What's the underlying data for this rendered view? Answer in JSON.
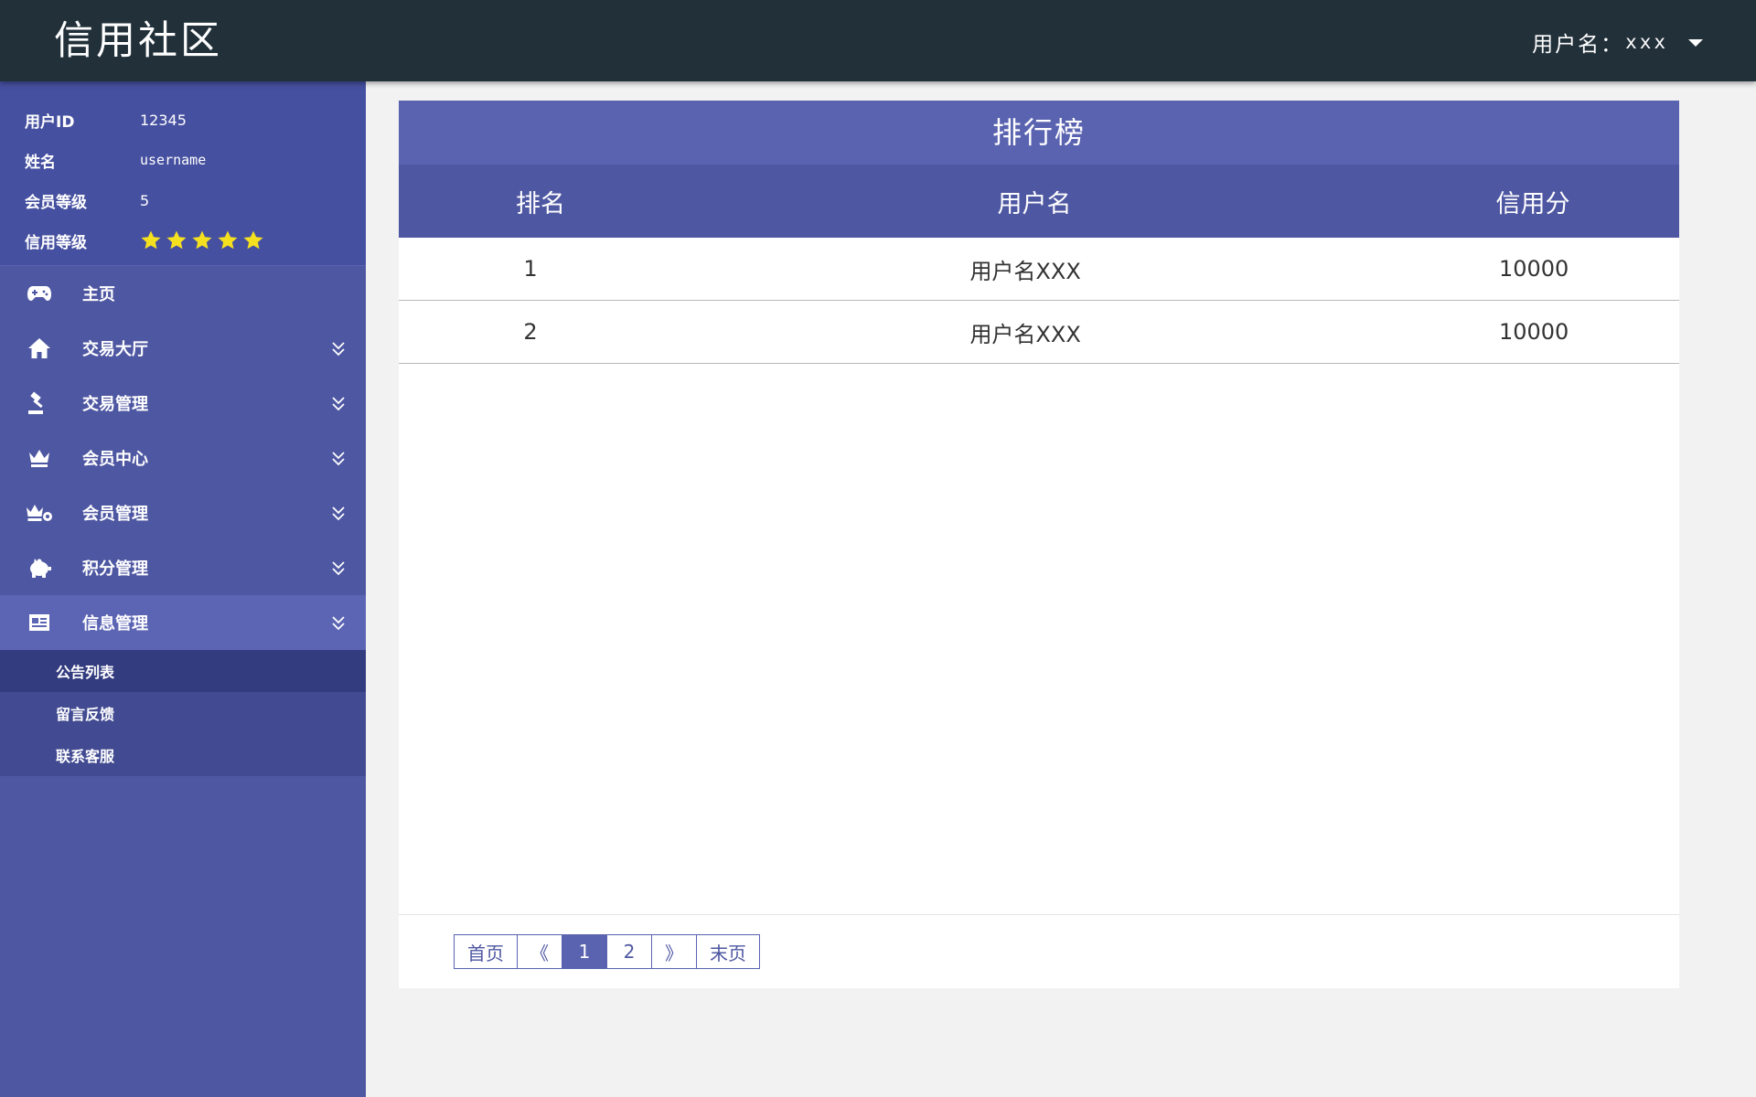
{
  "header": {
    "brand": "信用社区",
    "user_prefix": "用户名：",
    "user_name": "xxx"
  },
  "profile": {
    "rows": [
      {
        "label": "用户ID",
        "value": "12345"
      },
      {
        "label": "姓名",
        "value": "username"
      },
      {
        "label": "会员等级",
        "value": "5"
      },
      {
        "label": "信用等级",
        "value": ""
      }
    ],
    "credit_stars": 5,
    "star_color": "#f5e020"
  },
  "sidebar": {
    "items": [
      {
        "label": "主页",
        "icon": "gamepad-icon"
      },
      {
        "label": "交易大厅",
        "icon": "home-icon"
      },
      {
        "label": "交易管理",
        "icon": "gavel-icon"
      },
      {
        "label": "会员中心",
        "icon": "crown-icon"
      },
      {
        "label": "会员管理",
        "icon": "crown-gear-icon"
      },
      {
        "label": "积分管理",
        "icon": "piggy-bank-icon"
      },
      {
        "label": "信息管理",
        "icon": "newspaper-icon"
      }
    ],
    "submenu": [
      {
        "label": "公告列表"
      },
      {
        "label": "留言反馈"
      },
      {
        "label": "联系客服"
      }
    ]
  },
  "panel": {
    "title": "排行榜",
    "columns": [
      "排名",
      "用户名",
      "信用分"
    ],
    "rows": [
      {
        "rank": "1",
        "user": "用户名XXX",
        "score": "10000"
      },
      {
        "rank": "2",
        "user": "用户名XXX",
        "score": "10000"
      }
    ]
  },
  "pager": {
    "first": "首页",
    "prev": "《",
    "pages": [
      "1",
      "2"
    ],
    "current_page": "1",
    "next": "》",
    "last": "末页"
  },
  "colors": {
    "topbar": "#22303a",
    "sidebar": "#4e57a2",
    "accent": "#5a63b0"
  }
}
